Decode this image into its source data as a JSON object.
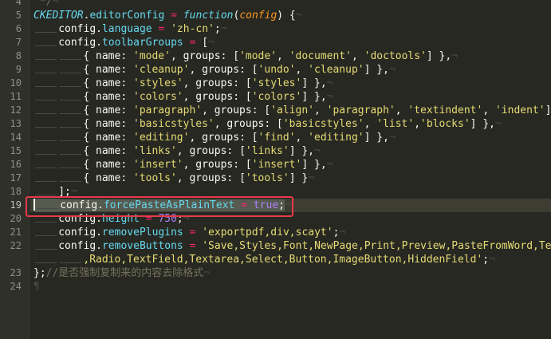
{
  "colors": {
    "background": "#272822",
    "highlight_box": "#e8394a"
  },
  "editor": {
    "lines": [
      {
        "num": "4",
        "ind": 0,
        "t": [
          [
            "t-cmt",
            " */"
          ],
          [
            "t-eol",
            "¬"
          ]
        ]
      },
      {
        "num": "5",
        "ind": 0,
        "t": [
          [
            "t-cls",
            "CKEDITOR"
          ],
          [
            "t-pun",
            "."
          ],
          [
            "t-prop",
            "editorConfig"
          ],
          [
            "t-pun",
            " "
          ],
          [
            "t-op",
            "="
          ],
          [
            "t-pun",
            " "
          ],
          [
            "t-kw",
            "function"
          ],
          [
            "t-pun",
            "("
          ],
          [
            "t-par",
            "config"
          ],
          [
            "t-pun",
            ") {"
          ],
          [
            "t-eol",
            "¬"
          ]
        ]
      },
      {
        "num": "6",
        "ind": 1,
        "t": [
          [
            "t-pun",
            "config."
          ],
          [
            "t-prop",
            "language"
          ],
          [
            "t-pun",
            " "
          ],
          [
            "t-op",
            "="
          ],
          [
            "t-pun",
            " "
          ],
          [
            "t-str",
            "'zh-cn'"
          ],
          [
            "t-pun",
            ";"
          ],
          [
            "t-eol",
            "¬"
          ]
        ]
      },
      {
        "num": "7",
        "ind": 1,
        "t": [
          [
            "t-pun",
            "config."
          ],
          [
            "t-prop",
            "toolbarGroups"
          ],
          [
            "t-pun",
            " "
          ],
          [
            "t-op",
            "="
          ],
          [
            "t-pun",
            " ["
          ],
          [
            "t-eol",
            "¬"
          ]
        ]
      },
      {
        "num": "8",
        "ind": 2,
        "t": [
          [
            "t-pun",
            "{ name: "
          ],
          [
            "t-str",
            "'mode'"
          ],
          [
            "t-pun",
            ", groups: ["
          ],
          [
            "t-str",
            "'mode'"
          ],
          [
            "t-pun",
            ", "
          ],
          [
            "t-str",
            "'document'"
          ],
          [
            "t-pun",
            ", "
          ],
          [
            "t-str",
            "'doctools'"
          ],
          [
            "t-pun",
            "] },"
          ],
          [
            "t-eol",
            "¬"
          ]
        ]
      },
      {
        "num": "9",
        "ind": 2,
        "t": [
          [
            "t-pun",
            "{ name: "
          ],
          [
            "t-str",
            "'cleanup'"
          ],
          [
            "t-pun",
            ", groups: ["
          ],
          [
            "t-str",
            "'undo'"
          ],
          [
            "t-pun",
            ", "
          ],
          [
            "t-str",
            "'cleanup'"
          ],
          [
            "t-pun",
            "] },"
          ],
          [
            "t-eol",
            "¬"
          ]
        ]
      },
      {
        "num": "10",
        "ind": 2,
        "t": [
          [
            "t-pun",
            "{ name: "
          ],
          [
            "t-str",
            "'styles'"
          ],
          [
            "t-pun",
            ", groups: ["
          ],
          [
            "t-str",
            "'styles'"
          ],
          [
            "t-pun",
            "] },"
          ],
          [
            "t-eol",
            "¬"
          ]
        ]
      },
      {
        "num": "11",
        "ind": 2,
        "t": [
          [
            "t-pun",
            "{ name: "
          ],
          [
            "t-str",
            "'colors'"
          ],
          [
            "t-pun",
            ", groups: ["
          ],
          [
            "t-str",
            "'colors'"
          ],
          [
            "t-pun",
            "] },"
          ],
          [
            "t-eol",
            "¬"
          ]
        ]
      },
      {
        "num": "12",
        "ind": 2,
        "t": [
          [
            "t-pun",
            "{ name: "
          ],
          [
            "t-str",
            "'paragraph'"
          ],
          [
            "t-pun",
            ", groups: ["
          ],
          [
            "t-str",
            "'align'"
          ],
          [
            "t-pun",
            ", "
          ],
          [
            "t-str",
            "'paragraph'"
          ],
          [
            "t-pun",
            ", "
          ],
          [
            "t-str",
            "'textindent'"
          ],
          [
            "t-pun",
            ", "
          ],
          [
            "t-str",
            "'indent'"
          ],
          [
            "t-pun",
            "] },"
          ]
        ]
      },
      {
        "num": "13",
        "ind": 2,
        "t": [
          [
            "t-pun",
            "{ name: "
          ],
          [
            "t-str",
            "'basicstyles'"
          ],
          [
            "t-pun",
            ", groups: ["
          ],
          [
            "t-str",
            "'basicstyles'"
          ],
          [
            "t-pun",
            ", "
          ],
          [
            "t-str",
            "'list'"
          ],
          [
            "t-pun",
            ","
          ],
          [
            "t-str",
            "'blocks'"
          ],
          [
            "t-pun",
            "] },"
          ],
          [
            "t-eol",
            "¬"
          ]
        ]
      },
      {
        "num": "14",
        "ind": 2,
        "t": [
          [
            "t-pun",
            "{ name: "
          ],
          [
            "t-str",
            "'editing'"
          ],
          [
            "t-pun",
            ", groups: ["
          ],
          [
            "t-str",
            "'find'"
          ],
          [
            "t-pun",
            ", "
          ],
          [
            "t-str",
            "'editing'"
          ],
          [
            "t-pun",
            "] },"
          ],
          [
            "t-eol",
            "¬"
          ]
        ]
      },
      {
        "num": "15",
        "ind": 2,
        "t": [
          [
            "t-pun",
            "{ name: "
          ],
          [
            "t-str",
            "'links'"
          ],
          [
            "t-pun",
            ", groups: ["
          ],
          [
            "t-str",
            "'links'"
          ],
          [
            "t-pun",
            "] },"
          ],
          [
            "t-eol",
            "¬"
          ]
        ]
      },
      {
        "num": "16",
        "ind": 2,
        "t": [
          [
            "t-pun",
            "{ name: "
          ],
          [
            "t-str",
            "'insert'"
          ],
          [
            "t-pun",
            ", groups: ["
          ],
          [
            "t-str",
            "'insert'"
          ],
          [
            "t-pun",
            "] },"
          ],
          [
            "t-eol",
            "¬"
          ]
        ]
      },
      {
        "num": "17",
        "ind": 2,
        "t": [
          [
            "t-pun",
            "{ name: "
          ],
          [
            "t-str",
            "'tools'"
          ],
          [
            "t-pun",
            ", groups: ["
          ],
          [
            "t-str",
            "'tools'"
          ],
          [
            "t-pun",
            "] }"
          ],
          [
            "t-eol",
            "¬"
          ]
        ]
      },
      {
        "num": "18",
        "ind": 1,
        "t": [
          [
            "t-pun",
            "];"
          ],
          [
            "t-eol",
            "¬"
          ]
        ]
      },
      {
        "num": "19",
        "ind": 1,
        "current": true,
        "t": [
          [
            "t-pun sel",
            "config."
          ],
          [
            "t-prop sel",
            "forcePasteAsPlainText"
          ],
          [
            "t-pun sel",
            " "
          ],
          [
            "t-op sel",
            "="
          ],
          [
            "t-pun sel",
            " "
          ],
          [
            "t-const sel",
            "true"
          ],
          [
            "t-pun sel",
            ";"
          ],
          [
            "t-eol",
            "¬"
          ]
        ]
      },
      {
        "num": "20",
        "ind": 1,
        "t": [
          [
            "t-pun",
            "config."
          ],
          [
            "t-prop",
            "height"
          ],
          [
            "t-pun",
            " "
          ],
          [
            "t-op",
            "="
          ],
          [
            "t-pun",
            " "
          ],
          [
            "t-num",
            "750"
          ],
          [
            "t-pun",
            ";"
          ],
          [
            "t-eol",
            "¬"
          ]
        ]
      },
      {
        "num": "21",
        "ind": 1,
        "t": [
          [
            "t-pun",
            "config."
          ],
          [
            "t-prop",
            "removePlugins"
          ],
          [
            "t-pun",
            " "
          ],
          [
            "t-op",
            "="
          ],
          [
            "t-pun",
            " "
          ],
          [
            "t-str",
            "'exportpdf,div,scayt'"
          ],
          [
            "t-pun",
            ";"
          ],
          [
            "t-eol",
            "¬"
          ]
        ]
      },
      {
        "num": "22",
        "ind": 1,
        "t": [
          [
            "t-pun",
            "config."
          ],
          [
            "t-prop",
            "removeButtons"
          ],
          [
            "t-pun",
            " "
          ],
          [
            "t-op",
            "="
          ],
          [
            "t-pun",
            " "
          ],
          [
            "t-str",
            "'Save,Styles,Font,NewPage,Print,Preview,PasteFromWord,Temp"
          ]
        ]
      },
      {
        "num": "",
        "ind": 2,
        "t": [
          [
            "t-str",
            ",Radio,TextField,Textarea,Select,Button,ImageButton,HiddenField'"
          ],
          [
            "t-pun",
            ";"
          ],
          [
            "t-eol",
            "¬"
          ]
        ]
      },
      {
        "num": "23",
        "ind": 0,
        "t": [
          [
            "t-pun",
            "};"
          ],
          [
            "t-cmt",
            "//是否强制复制来的内容去除格式"
          ],
          [
            "t-eol",
            "¬"
          ]
        ]
      },
      {
        "num": "24",
        "ind": 0,
        "t": [
          [
            "t-eol",
            "¶"
          ]
        ]
      }
    ]
  }
}
